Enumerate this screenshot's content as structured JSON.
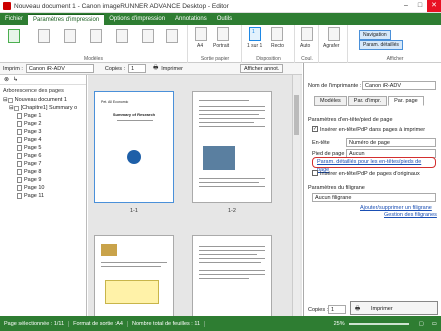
{
  "window": {
    "title": "Nouveau document 1 - Canon imageRUNNER ADVANCE Desktop - Editor",
    "min": "–",
    "max": "□",
    "close": "✕"
  },
  "tabs": [
    {
      "label": "Fichier"
    },
    {
      "label": "Paramètres d'impression"
    },
    {
      "label": "Options d'impression"
    },
    {
      "label": "Annotations"
    },
    {
      "label": "Outils"
    }
  ],
  "ribbon": {
    "group_modeles": "Modèles",
    "group_sortie": "Sortie papier",
    "group_disposition": "Disposition",
    "group_coul": "Coul.",
    "group_afficher": "Afficher",
    "btn_a4": "A4",
    "btn_portrait": "Portrait",
    "btn_1": "1",
    "btn_1sur1": "1 sur 1",
    "btn_recto": "Recto",
    "btn_auto": "Auto",
    "btn_agrafer": "Agrafer",
    "btn_navigation": "Navigation",
    "btn_param_details": "Param. détaillés"
  },
  "toolbar2": {
    "imprim_label": "Imprim :",
    "printer": "Canon iR-ADV",
    "copies_label": "Copies :",
    "copies_value": "1",
    "imprimer": "Imprimer",
    "afficher_annot": "Afficher annot."
  },
  "leftpane": {
    "header": "Arborescence des pages",
    "root": "Nouveau document 1",
    "chapter": "[Chapitre1] Summary o",
    "pages": [
      "Page 1",
      "Page 2",
      "Page 3",
      "Page 4",
      "Page 5",
      "Page 6",
      "Page 7",
      "Page 8",
      "Page 9",
      "Page 10",
      "Page 11"
    ]
  },
  "docarea": {
    "label_1_1": "1-1",
    "label_1_2": "1-2",
    "p1_title": "Summary of Research",
    "p1_header": "Pet. All Economic"
  },
  "rightpane": {
    "printer_label": "Nom de l'imprimante :",
    "printer_value": "Canon iR-ADV",
    "tabs": [
      "Modèles",
      "Par. d'impr.",
      "Par. page"
    ],
    "section_entete": "Paramètres d'en-tête/pied de page",
    "chk_inserer": "Insérer en-tête/PdP dans pages à imprimer",
    "entete_label": "En-tête",
    "entete_value": "Numéro de page",
    "pied_label": "Pied de page",
    "pied_value": "Aucun",
    "link_param": "Param. détaillés pour les en-têtes/pieds de page",
    "chk_originaux": "Insérer en-tête/PdP de pages d'originaux",
    "section_filigrane": "Paramètres du filigrane",
    "filigrane_value": "Aucun filigrane",
    "link_ajouter": "Ajouter/supprimer un filigrane",
    "link_gestion": "Gestion des filigranes",
    "copies_label": "Copies :",
    "copies_value": "1",
    "imprimer": "Imprimer"
  },
  "status": {
    "page_sel": "Page sélectionnée : 1/11",
    "format": "Format de sortie :A4",
    "feuilles": "Nombre total de feuilles : 11",
    "zoom": "25%"
  },
  "colors": {
    "brand": "#2e7d32",
    "highlight": "#d32f2f",
    "link": "#1a4fb4"
  }
}
